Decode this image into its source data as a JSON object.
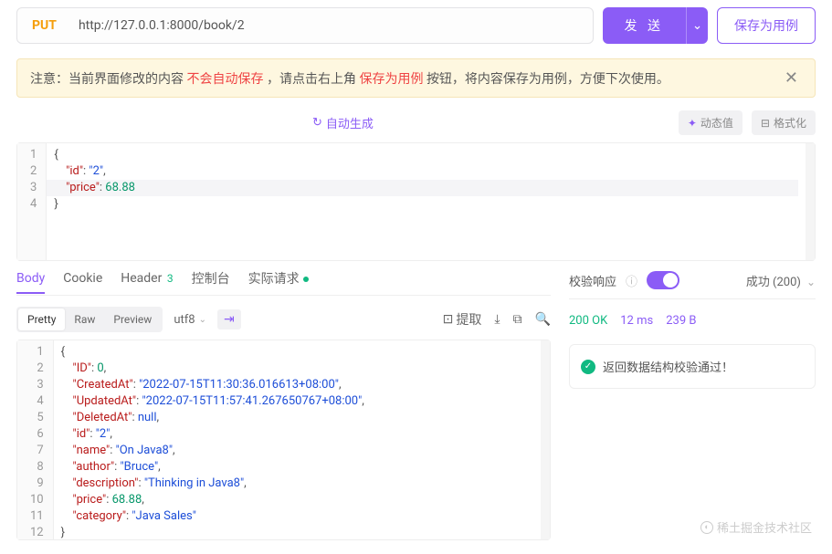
{
  "request": {
    "method": "PUT",
    "url": "http://127.0.0.1:8000/book/2",
    "send_label": "发 送",
    "save_example_label": "保存为用例"
  },
  "warning": {
    "prefix": "注意：当前界面修改的内容 ",
    "no_autosave": "不会自动保存",
    "mid": " ，请点击右上角 ",
    "save_btn": "保存为用例",
    "suffix": " 按钮，将内容保存为用例，方便下次使用。"
  },
  "editor_toolbar": {
    "autogen": "自动生成",
    "dynamic": "动态值",
    "format": "格式化"
  },
  "request_body_lines": [
    [
      {
        "t": "brace",
        "v": "{"
      }
    ],
    [
      {
        "t": "pad",
        "v": "    "
      },
      {
        "t": "key",
        "v": "\"id\""
      },
      {
        "t": "colon",
        "v": ": "
      },
      {
        "t": "str",
        "v": "\"2\""
      },
      {
        "t": "colon",
        "v": ","
      }
    ],
    [
      {
        "t": "pad",
        "v": "    "
      },
      {
        "t": "key",
        "v": "\"price\""
      },
      {
        "t": "colon",
        "v": ": "
      },
      {
        "t": "num",
        "v": "68.88"
      }
    ],
    [
      {
        "t": "brace",
        "v": "}"
      }
    ]
  ],
  "response_tabs": {
    "body": "Body",
    "cookie": "Cookie",
    "header": "Header",
    "header_count": "3",
    "console": "控制台",
    "actual": "实际请求"
  },
  "view_modes": {
    "pretty": "Pretty",
    "raw": "Raw",
    "preview": "Preview"
  },
  "encoding": "utf8",
  "extract_label": "提取",
  "response_body_lines": [
    [
      {
        "t": "brace",
        "v": "{"
      }
    ],
    [
      {
        "t": "pad",
        "v": "    "
      },
      {
        "t": "key",
        "v": "\"ID\""
      },
      {
        "t": "colon",
        "v": ": "
      },
      {
        "t": "num",
        "v": "0"
      },
      {
        "t": "colon",
        "v": ","
      }
    ],
    [
      {
        "t": "pad",
        "v": "    "
      },
      {
        "t": "key",
        "v": "\"CreatedAt\""
      },
      {
        "t": "colon",
        "v": ": "
      },
      {
        "t": "str",
        "v": "\"2022-07-15T11:30:36.016613+08:00\""
      },
      {
        "t": "colon",
        "v": ","
      }
    ],
    [
      {
        "t": "pad",
        "v": "    "
      },
      {
        "t": "key",
        "v": "\"UpdatedAt\""
      },
      {
        "t": "colon",
        "v": ": "
      },
      {
        "t": "str",
        "v": "\"2022-07-15T11:57:41.267650767+08:00\""
      },
      {
        "t": "colon",
        "v": ","
      }
    ],
    [
      {
        "t": "pad",
        "v": "    "
      },
      {
        "t": "key",
        "v": "\"DeletedAt\""
      },
      {
        "t": "colon",
        "v": ": "
      },
      {
        "t": "null",
        "v": "null"
      },
      {
        "t": "colon",
        "v": ","
      }
    ],
    [
      {
        "t": "pad",
        "v": "    "
      },
      {
        "t": "key",
        "v": "\"id\""
      },
      {
        "t": "colon",
        "v": ": "
      },
      {
        "t": "str",
        "v": "\"2\""
      },
      {
        "t": "colon",
        "v": ","
      }
    ],
    [
      {
        "t": "pad",
        "v": "    "
      },
      {
        "t": "key",
        "v": "\"name\""
      },
      {
        "t": "colon",
        "v": ": "
      },
      {
        "t": "str",
        "v": "\"On Java8\""
      },
      {
        "t": "colon",
        "v": ","
      }
    ],
    [
      {
        "t": "pad",
        "v": "    "
      },
      {
        "t": "key",
        "v": "\"author\""
      },
      {
        "t": "colon",
        "v": ": "
      },
      {
        "t": "str",
        "v": "\"Bruce\""
      },
      {
        "t": "colon",
        "v": ","
      }
    ],
    [
      {
        "t": "pad",
        "v": "    "
      },
      {
        "t": "key",
        "v": "\"description\""
      },
      {
        "t": "colon",
        "v": ": "
      },
      {
        "t": "str",
        "v": "\"Thinking in Java8\""
      },
      {
        "t": "colon",
        "v": ","
      }
    ],
    [
      {
        "t": "pad",
        "v": "    "
      },
      {
        "t": "key",
        "v": "\"price\""
      },
      {
        "t": "colon",
        "v": ": "
      },
      {
        "t": "num",
        "v": "68.88"
      },
      {
        "t": "colon",
        "v": ","
      }
    ],
    [
      {
        "t": "pad",
        "v": "    "
      },
      {
        "t": "key",
        "v": "\"category\""
      },
      {
        "t": "colon",
        "v": ": "
      },
      {
        "t": "str",
        "v": "\"Java Sales\""
      }
    ],
    [
      {
        "t": "brace",
        "v": "}"
      }
    ]
  ],
  "right_panel": {
    "verify_label": "校验响应",
    "success_label": "成功 (200)",
    "status": "200 OK",
    "time": "12 ms",
    "size": "239 B",
    "validation_msg": "返回数据结构校验通过！"
  },
  "watermark": "稀土掘金技术社区"
}
